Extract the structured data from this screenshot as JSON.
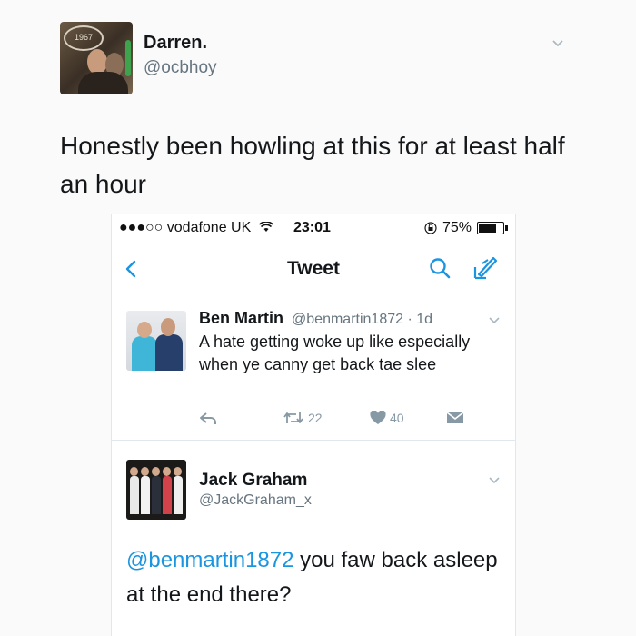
{
  "outer_tweet": {
    "name": "Darren.",
    "handle": "@ocbhoy",
    "avatar_badge": "1967",
    "text": "Honestly been howling at this for at least half an hour"
  },
  "phone": {
    "status_bar": {
      "carrier": "●●●○○ vodafone UK",
      "time": "23:01",
      "battery": "75%"
    },
    "nav": {
      "title": "Tweet"
    },
    "tweet": {
      "name": "Ben Martin",
      "handle_time": "@benmartin1872 · 1d",
      "text": "A hate getting woke up like especially when ye canny get back tae slee",
      "retweets": "22",
      "likes": "40"
    },
    "reply": {
      "name": "Jack Graham",
      "handle": "@JackGraham_x",
      "mention": "@benmartin1872",
      "text": " you faw back asleep at the end there?"
    }
  },
  "colors": {
    "link_blue": "#1b95e0",
    "ios_blue": "#1b95e0",
    "muted_gray": "#66757f"
  },
  "icons": [
    "chevron-down-icon",
    "back-chevron-icon",
    "search-icon",
    "compose-icon",
    "wifi-icon",
    "reply-icon",
    "retweet-icon",
    "heart-icon",
    "direct-message-icon",
    "battery-icon"
  ]
}
